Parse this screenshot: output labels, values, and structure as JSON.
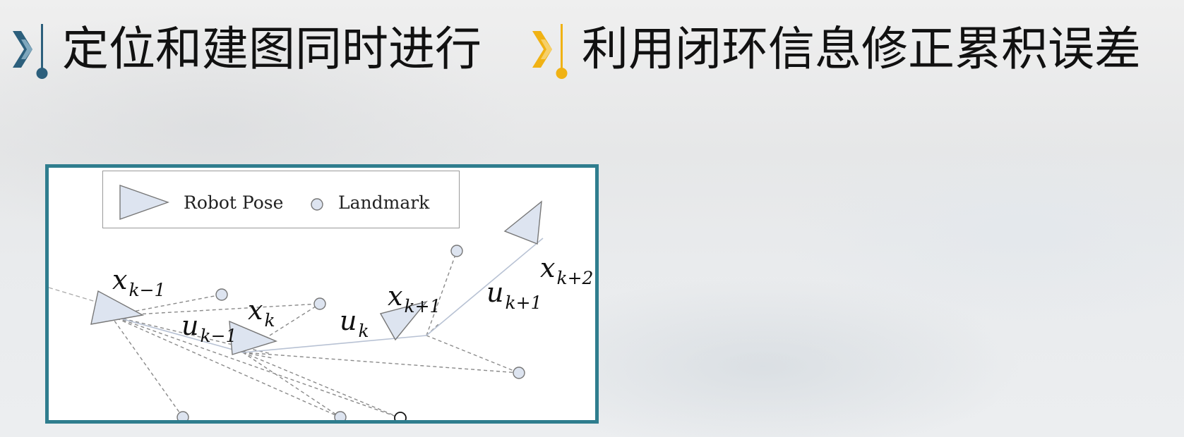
{
  "header": {
    "left_title": "定位和建图同时进行",
    "right_title": "利用闭环信息修正累积误差",
    "left_marker_icon": "chevron-pin-icon",
    "right_marker_icon": "chevron-pin-icon",
    "left_marker_color": "#2c5f7c",
    "right_marker_color": "#f0b214"
  },
  "figure": {
    "frame_color": "#2f7d8e",
    "legend": {
      "robot_pose_label": "Robot Pose",
      "landmark_label": "Landmark",
      "robot_pose_icon": "triangle-icon",
      "landmark_icon": "circle-icon"
    },
    "labels": {
      "x_km1": {
        "base": "x",
        "sub": "k−1"
      },
      "x_k": {
        "base": "x",
        "sub": "k"
      },
      "x_kp1": {
        "base": "x",
        "sub": "k+1"
      },
      "x_kp2": {
        "base": "x",
        "sub": "k+2"
      },
      "u_km1": {
        "base": "u",
        "sub": "k−1"
      },
      "u_k": {
        "base": "u",
        "sub": "k"
      },
      "u_kp1": {
        "base": "u",
        "sub": "k+1"
      }
    },
    "pose_fill": "#dde4f0",
    "landmark_fill": "#dde4f0",
    "loop_closure_landmark_fill": "#ffffff"
  }
}
